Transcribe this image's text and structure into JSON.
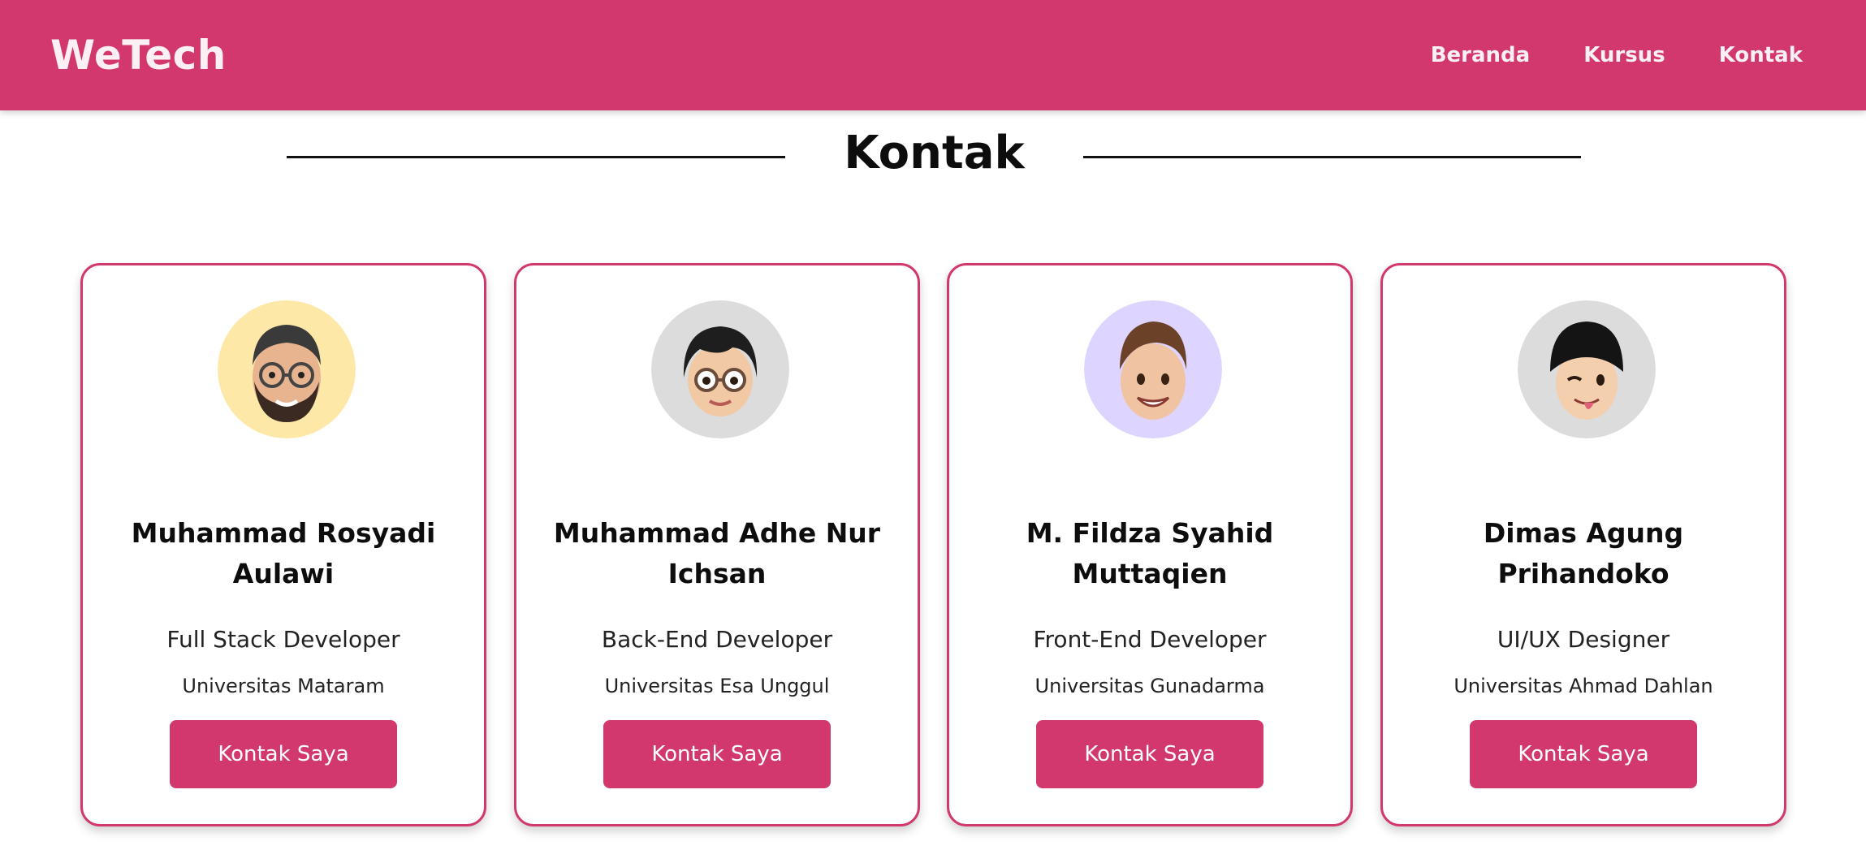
{
  "navbar": {
    "brand": "WeTech",
    "links": [
      {
        "label": "Beranda"
      },
      {
        "label": "Kursus"
      },
      {
        "label": "Kontak"
      }
    ]
  },
  "section": {
    "title": "Kontak"
  },
  "cards": [
    {
      "name": "Muhammad Rosyadi Aulawi",
      "role": "Full Stack Developer",
      "university": "Universitas Mataram",
      "button_label": "Kontak Saya",
      "avatar_icon": "memoji-bearded-glasses-icon",
      "avatar_bg": "#fde8a8"
    },
    {
      "name": "Muhammad Adhe Nur Ichsan",
      "role": "Back-End Developer",
      "university": "Universitas Esa Unggul",
      "button_label": "Kontak Saya",
      "avatar_icon": "memoji-glasses-icon",
      "avatar_bg": "#dcdcdc"
    },
    {
      "name": "M. Fildza Syahid Muttaqien",
      "role": "Front-End Developer",
      "university": "Universitas Gunadarma",
      "button_label": "Kontak Saya",
      "avatar_icon": "memoji-smiling-icon",
      "avatar_bg": "#ddd4ff"
    },
    {
      "name": "Dimas Agung Prihandoko",
      "role": "UI/UX Designer",
      "university": "Universitas Ahmad Dahlan",
      "button_label": "Kontak Saya",
      "avatar_icon": "memoji-winking-beanie-icon",
      "avatar_bg": "#dcdcdc"
    }
  ],
  "colors": {
    "accent": "#d2386d",
    "text": "#0d0d0d"
  }
}
